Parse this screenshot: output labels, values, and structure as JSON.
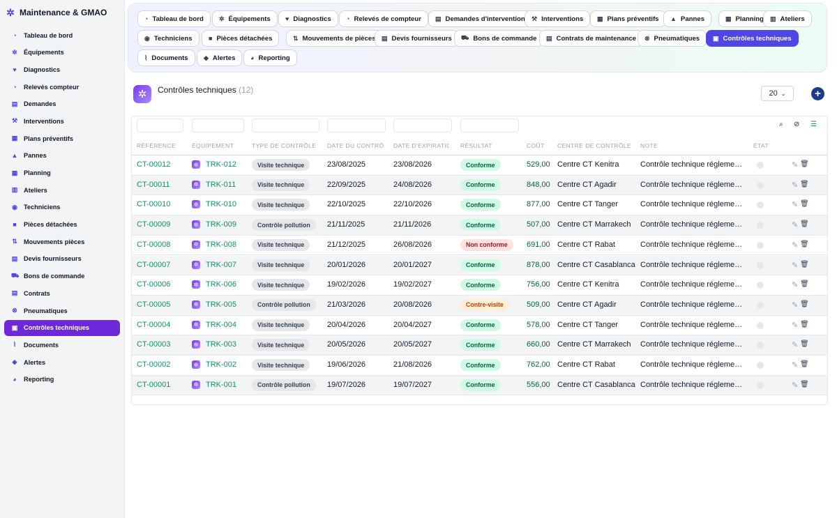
{
  "app": {
    "title": "Maintenance & GMAO",
    "brand_icon": "gears-icon"
  },
  "sidebar": {
    "items": [
      {
        "label": "Tableau de bord",
        "icon": "dashboard-icon",
        "glyph": "◔"
      },
      {
        "label": "Équipements",
        "icon": "gears-icon",
        "glyph": "✲"
      },
      {
        "label": "Diagnostics",
        "icon": "heart-pulse-icon",
        "glyph": "♥"
      },
      {
        "label": "Relevés compteur",
        "icon": "gauge-icon",
        "glyph": "◔"
      },
      {
        "label": "Demandes",
        "icon": "clipboard-icon",
        "glyph": "▤"
      },
      {
        "label": "Interventions",
        "icon": "wrench-icon",
        "glyph": "⚒"
      },
      {
        "label": "Plans préventifs",
        "icon": "calendar-check-icon",
        "glyph": "▦"
      },
      {
        "label": "Pannes",
        "icon": "warning-icon",
        "glyph": "▲"
      },
      {
        "label": "Planning",
        "icon": "calendar-icon",
        "glyph": "▦"
      },
      {
        "label": "Ateliers",
        "icon": "warehouse-icon",
        "glyph": "▥"
      },
      {
        "label": "Techniciens",
        "icon": "users-gear-icon",
        "glyph": "◉"
      },
      {
        "label": "Pièces détachées",
        "icon": "box-icon",
        "glyph": "■"
      },
      {
        "label": "Mouvements pièces",
        "icon": "dolly-icon",
        "glyph": "⇅"
      },
      {
        "label": "Devis fournisseurs",
        "icon": "file-invoice-icon",
        "glyph": "▤"
      },
      {
        "label": "Bons de commande",
        "icon": "cart-icon",
        "glyph": "⛟"
      },
      {
        "label": "Contrats",
        "icon": "file-contract-icon",
        "glyph": "▤"
      },
      {
        "label": "Pneumatiques",
        "icon": "tire-icon",
        "glyph": "⊗"
      },
      {
        "label": "Contrôles techniques",
        "icon": "clipboard-check-icon",
        "glyph": "▣",
        "active": true
      },
      {
        "label": "Documents",
        "icon": "paperclip-icon",
        "glyph": "⌇"
      },
      {
        "label": "Alertes",
        "icon": "bell-icon",
        "glyph": "◆"
      },
      {
        "label": "Reporting",
        "icon": "chart-pie-icon",
        "glyph": "◕"
      }
    ]
  },
  "tabs": [
    {
      "label": "Tableau de bord",
      "icon": "dashboard-icon",
      "glyph": "◔"
    },
    {
      "label": "Équipements",
      "icon": "gears-icon",
      "glyph": "✲"
    },
    {
      "label": "Diagnostics",
      "icon": "heart-pulse-icon",
      "glyph": "♥"
    },
    {
      "label": "Relevés de compteur",
      "icon": "gauge-icon",
      "glyph": "◔"
    },
    {
      "label": "Demandes d'intervention",
      "icon": "clipboard-icon",
      "glyph": "▤"
    },
    {
      "label": "Interventions",
      "icon": "wrench-icon",
      "glyph": "⚒"
    },
    {
      "label": "Plans préventifs",
      "icon": "calendar-check-icon",
      "glyph": "▦"
    },
    {
      "label": "Pannes",
      "icon": "warning-icon",
      "glyph": "▲"
    },
    {
      "label": "Planning",
      "icon": "calendar-icon",
      "glyph": "▦"
    },
    {
      "label": "Ateliers",
      "icon": "warehouse-icon",
      "glyph": "▥"
    },
    {
      "label": "Techniciens",
      "icon": "users-gear-icon",
      "glyph": "◉"
    },
    {
      "label": "Pièces détachées",
      "icon": "box-icon",
      "glyph": "■"
    },
    {
      "label": "Mouvements de pièces",
      "icon": "dolly-icon",
      "glyph": "⇅"
    },
    {
      "label": "Devis fournisseurs",
      "icon": "file-invoice-icon",
      "glyph": "▤"
    },
    {
      "label": "Bons de commande",
      "icon": "cart-icon",
      "glyph": "⛟"
    },
    {
      "label": "Contrats de maintenance",
      "icon": "file-contract-icon",
      "glyph": "▤"
    },
    {
      "label": "Pneumatiques",
      "icon": "tire-icon",
      "glyph": "⊗"
    },
    {
      "label": "Contrôles techniques",
      "icon": "clipboard-check-icon",
      "glyph": "▣",
      "active": true
    },
    {
      "label": "Documents",
      "icon": "paperclip-icon",
      "glyph": "⌇"
    },
    {
      "label": "Alertes",
      "icon": "bell-icon",
      "glyph": "◆"
    },
    {
      "label": "Reporting",
      "icon": "chart-pie-icon",
      "glyph": "◕"
    }
  ],
  "page": {
    "title": "Contrôles techniques",
    "count": "(12)",
    "per_page": "20",
    "icon": "gear-badge-icon",
    "add_icon": "plus-circle-icon"
  },
  "table": {
    "columns": [
      "RÉFÉRENCE",
      "ÉQUIPEMENT",
      "TYPE DE CONTRÔLE",
      "DATE DU CONTRÔLE",
      "DATE D'EXPIRATION",
      "RÉSULTAT",
      "COÛT",
      "CENTRE DE CONTRÔLE",
      "NOTE",
      "ÉTAT"
    ],
    "tools": [
      "search-icon",
      "filter-clear-icon",
      "column-list-icon"
    ],
    "rows": [
      {
        "ref": "CT-00012",
        "equip": "TRK-012",
        "type": "Visite technique",
        "date": "23/08/2025",
        "exp": "23/08/2026",
        "result": "Conforme",
        "result_kind": "ok",
        "cost": "529,00",
        "center": "Centre CT Kenitra",
        "note": "Contrôle technique réglementaire"
      },
      {
        "ref": "CT-00011",
        "equip": "TRK-011",
        "type": "Visite technique",
        "date": "22/09/2025",
        "exp": "24/08/2026",
        "result": "Conforme",
        "result_kind": "ok",
        "cost": "848,00",
        "center": "Centre CT Agadir",
        "note": "Contrôle technique réglementaire"
      },
      {
        "ref": "CT-00010",
        "equip": "TRK-010",
        "type": "Visite technique",
        "date": "22/10/2025",
        "exp": "22/10/2026",
        "result": "Conforme",
        "result_kind": "ok",
        "cost": "877,00",
        "center": "Centre CT Tanger",
        "note": "Contrôle technique réglementaire"
      },
      {
        "ref": "CT-00009",
        "equip": "TRK-009",
        "type": "Contrôle pollution",
        "date": "21/11/2025",
        "exp": "21/11/2026",
        "result": "Conforme",
        "result_kind": "ok",
        "cost": "507,00",
        "center": "Centre CT Marrakech",
        "note": "Contrôle technique réglementaire"
      },
      {
        "ref": "CT-00008",
        "equip": "TRK-008",
        "type": "Visite technique",
        "date": "21/12/2025",
        "exp": "26/08/2026",
        "result": "Non conforme",
        "result_kind": "ko",
        "cost": "691,00",
        "center": "Centre CT Rabat",
        "note": "Contrôle technique réglementaire"
      },
      {
        "ref": "CT-00007",
        "equip": "TRK-007",
        "type": "Visite technique",
        "date": "20/01/2026",
        "exp": "20/01/2027",
        "result": "Conforme",
        "result_kind": "ok",
        "cost": "878,00",
        "center": "Centre CT Casablanca",
        "note": "Contrôle technique réglementaire"
      },
      {
        "ref": "CT-00006",
        "equip": "TRK-006",
        "type": "Visite technique",
        "date": "19/02/2026",
        "exp": "19/02/2027",
        "result": "Conforme",
        "result_kind": "ok",
        "cost": "756,00",
        "center": "Centre CT Kenitra",
        "note": "Contrôle technique réglementaire"
      },
      {
        "ref": "CT-00005",
        "equip": "TRK-005",
        "type": "Contrôle pollution",
        "date": "21/03/2026",
        "exp": "20/08/2026",
        "result": "Contre-visite",
        "result_kind": "cv",
        "cost": "509,00",
        "center": "Centre CT Agadir",
        "note": "Contrôle technique réglementaire"
      },
      {
        "ref": "CT-00004",
        "equip": "TRK-004",
        "type": "Visite technique",
        "date": "20/04/2026",
        "exp": "20/04/2027",
        "result": "Conforme",
        "result_kind": "ok",
        "cost": "578,00",
        "center": "Centre CT Tanger",
        "note": "Contrôle technique réglementaire"
      },
      {
        "ref": "CT-00003",
        "equip": "TRK-003",
        "type": "Visite technique",
        "date": "20/05/2026",
        "exp": "20/05/2027",
        "result": "Conforme",
        "result_kind": "ok",
        "cost": "660,00",
        "center": "Centre CT Marrakech",
        "note": "Contrôle technique réglementaire"
      },
      {
        "ref": "CT-00002",
        "equip": "TRK-002",
        "type": "Visite technique",
        "date": "19/06/2026",
        "exp": "21/08/2026",
        "result": "Conforme",
        "result_kind": "ok",
        "cost": "762,00",
        "center": "Centre CT Rabat",
        "note": "Contrôle technique réglementaire"
      },
      {
        "ref": "CT-00001",
        "equip": "TRK-001",
        "type": "Contrôle pollution",
        "date": "19/07/2026",
        "exp": "19/07/2027",
        "result": "Conforme",
        "result_kind": "ok",
        "cost": "556,00",
        "center": "Centre CT Casablanca",
        "note": "Contrôle technique réglementaire"
      }
    ]
  },
  "colors": {
    "accent": "#4f46e5",
    "sidebar_active": "#6d28d9",
    "link": "#059669",
    "ok": "#d1fae5",
    "ko": "#fee2e2",
    "cv": "#ffedd5"
  }
}
